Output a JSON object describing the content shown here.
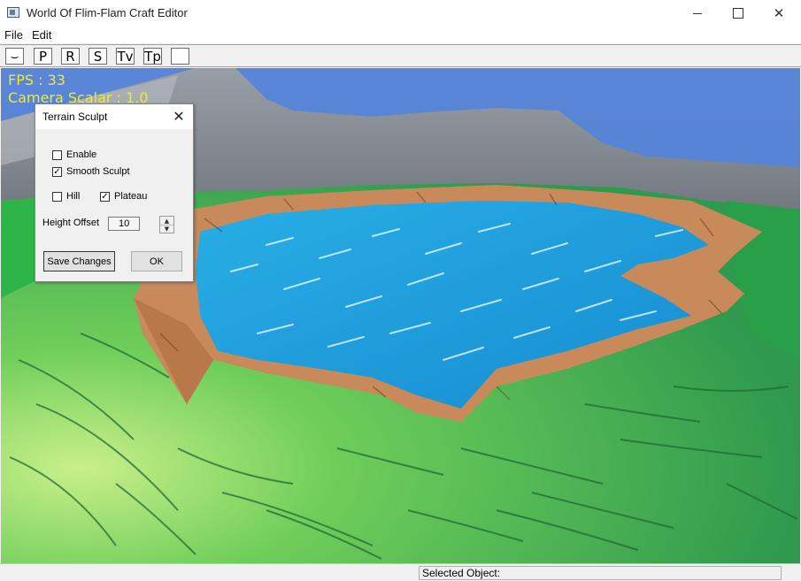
{
  "window": {
    "title": "World Of Flim-Flam Craft Editor",
    "icon": "app-window-icon",
    "minimize_icon": "minimize-icon",
    "maximize_icon": "maximize-icon",
    "close_glyph": "✕"
  },
  "menu": {
    "file": "File",
    "edit": "Edit"
  },
  "toolbar": {
    "buttons": [
      {
        "label": "⌣",
        "icon": "smiley-icon"
      },
      {
        "label": "P"
      },
      {
        "label": "R"
      },
      {
        "label": "S"
      },
      {
        "label": "Tv"
      },
      {
        "label": "Tp"
      },
      {
        "label": ""
      }
    ]
  },
  "viewport": {
    "fps": "FPS : 33",
    "camera_scalar": "Camera Scalar : 1.0",
    "hud_color": "#f1ec22",
    "sky_color": "#5b84d4",
    "water_color": "#1f9ad8",
    "grass_color": "#33b54a",
    "dirt_color": "#c98a5b",
    "mountain_color": "#7c8189"
  },
  "dialog": {
    "title": "Terrain Sculpt",
    "close_glyph": "✕",
    "enable": {
      "label": "Enable",
      "checked": false
    },
    "smooth_sculpt": {
      "label": "Smooth Sculpt",
      "checked": true
    },
    "hill": {
      "label": "Hill",
      "checked": false
    },
    "plateau": {
      "label": "Plateau",
      "checked": true
    },
    "height_offset_label": "Height Offset",
    "height_offset_value": "10",
    "spin_up": "▲",
    "spin_down": "▼",
    "save_button": "Save Changes",
    "ok_button": "OK"
  },
  "statusbar": {
    "selected_object": "Selected Object:"
  }
}
